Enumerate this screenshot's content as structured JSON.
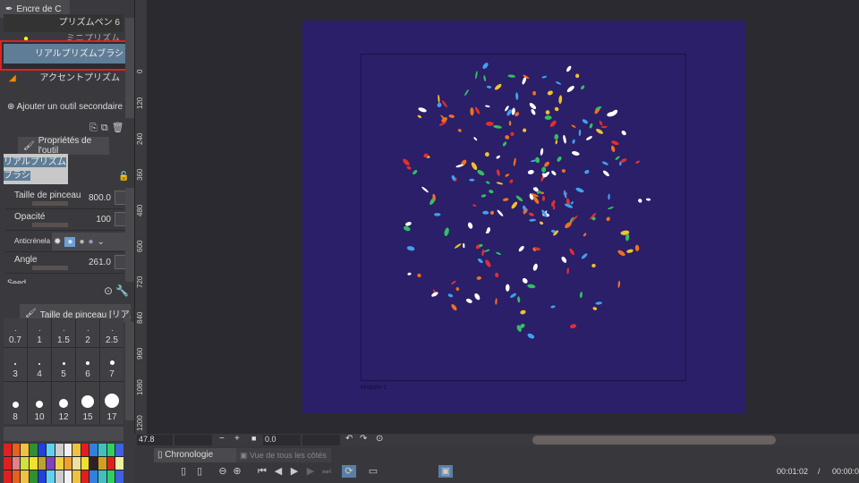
{
  "subtool_panel": {
    "tab_label": "Encre de C",
    "items": [
      "プリズムペン 6",
      "ミニプリズム",
      "リアルプリズムブラシ",
      "アクセントプリズム"
    ],
    "add_label": "Ajouter un outil secondaire"
  },
  "tool_props": {
    "tab_label": "Propriétés de l'outil",
    "tool_name": "リアルプリズムブラシ",
    "brush_size_label": "Taille de pinceau",
    "brush_size_value": "800.0",
    "opacity_label": "Opacité",
    "opacity_value": "100",
    "antialias_label": "Anticrénelage",
    "angle_label": "Angle",
    "angle_value": "261.0",
    "seed_label": "Seed"
  },
  "brush_size_panel": {
    "tab_label": "Taille de pinceau [リアルプリズ",
    "sizes": [
      "0.7",
      "1",
      "1.5",
      "2",
      "2.5",
      "3",
      "4",
      "5",
      "6",
      "7",
      "8",
      "10",
      "12",
      "15",
      "17"
    ]
  },
  "ruler": {
    "labels": [
      "0",
      "120",
      "240",
      "360",
      "480",
      "600",
      "720",
      "840",
      "960",
      "1080",
      "1200"
    ]
  },
  "canvas": {
    "color": "#2a1f68",
    "caption": "Histoire 1"
  },
  "statusbar": {
    "zoom": "47.8",
    "rotation": "0.0"
  },
  "timeline": {
    "tab_chrono": "Chronologie",
    "tab_view": "Vue de tous les côtés",
    "current_time": "00:01:02",
    "separator": "/",
    "total_time": "00:00:0"
  },
  "palette": [
    "#e02020",
    "#e86020",
    "#f0c040",
    "#309030",
    "#2040e0",
    "#60d0f0",
    "#cccccc",
    "#f0f0f0",
    "#f0c040",
    "#e02020",
    "#3080e0",
    "#40c0c0",
    "#30d060",
    "#4060e0",
    "#e02020",
    "#e08090",
    "#d0e040",
    "#f0e030",
    "#c0a030",
    "#8040c0",
    "#f0d040",
    "#f0a030",
    "#f0e0a0",
    "#f0e030",
    "#302020",
    "#d0a020",
    "#e02020",
    "#f0f0a0"
  ]
}
